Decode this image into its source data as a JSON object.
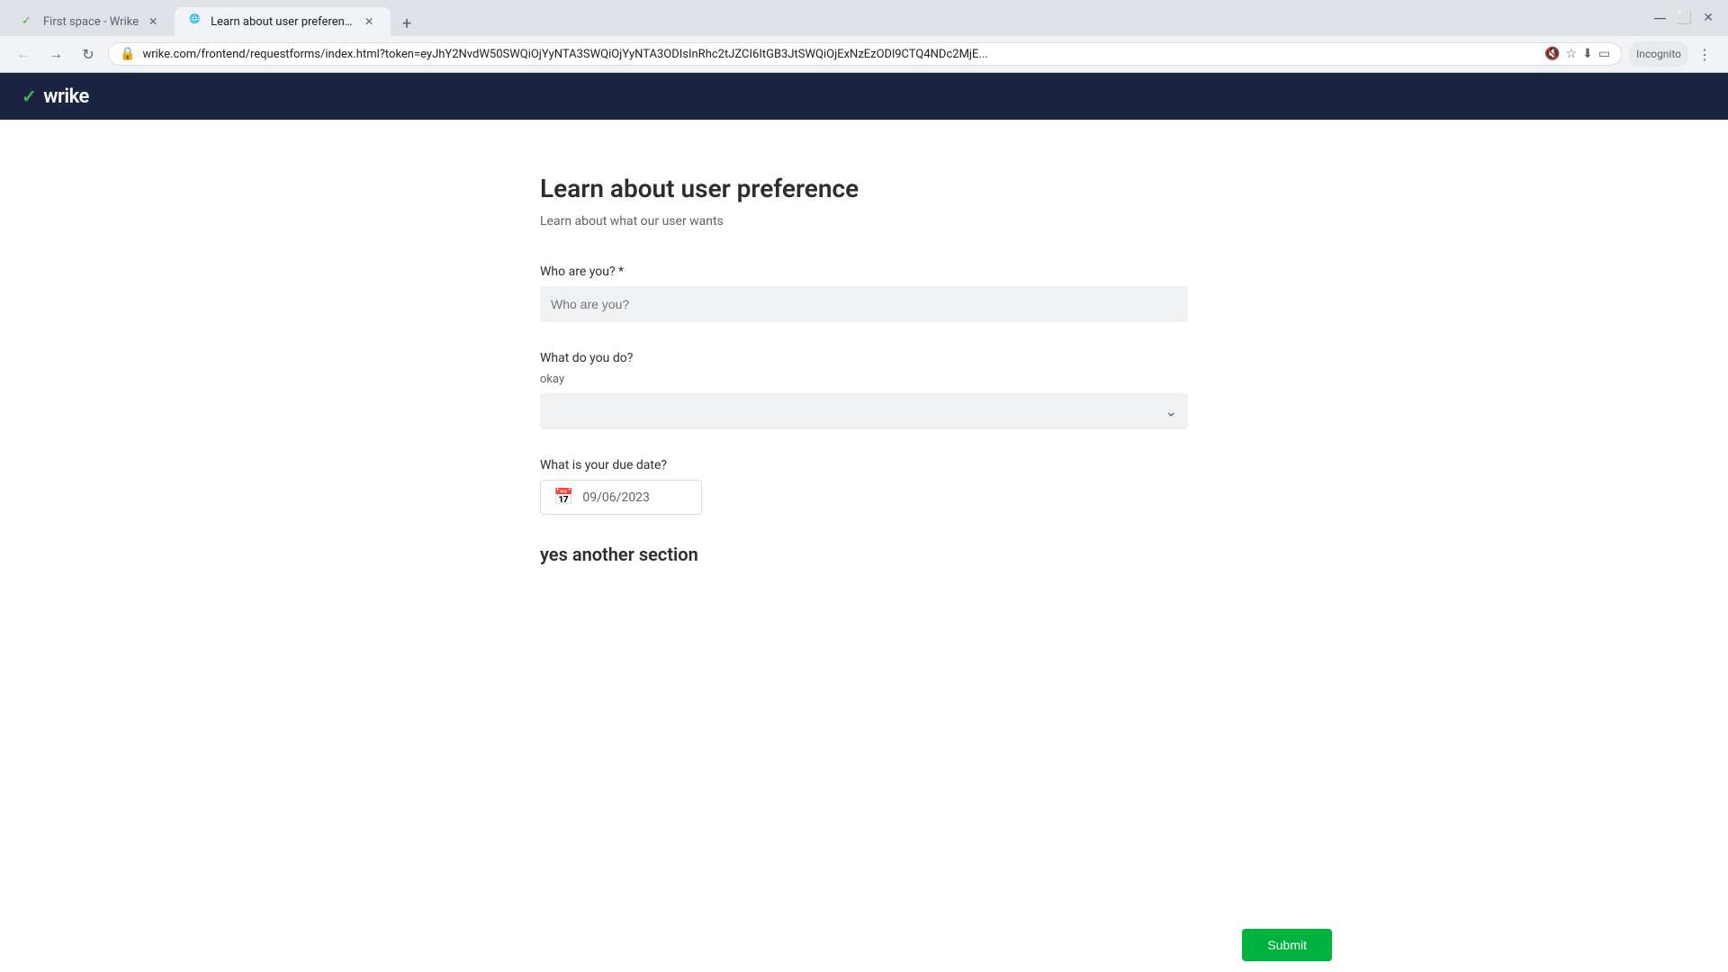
{
  "browser": {
    "tabs": [
      {
        "id": "tab-1",
        "title": "First space - Wrike",
        "favicon": "✓",
        "active": false,
        "closeable": true
      },
      {
        "id": "tab-2",
        "title": "Learn about user preference",
        "favicon": "●",
        "active": true,
        "closeable": true
      }
    ],
    "new_tab_label": "+",
    "url": "wrike.com/frontend/requestforms/index.html?token=eyJhY2NvdW50SWQiOjYyNTA3SWQiOjYyNTA3ODIsInRhc2tJZCI6ItGB3JtSWQiOjExNzEzODl9CTQ4NDc2MjE...",
    "toolbar": {
      "back_label": "←",
      "forward_label": "→",
      "reload_label": "↺",
      "incognito_label": "Incognito"
    }
  },
  "app": {
    "logo_text": "wrike",
    "logo_check": "✓"
  },
  "form": {
    "title": "Learn about user preference",
    "subtitle": "Learn about what our user wants",
    "fields": [
      {
        "id": "who-are-you",
        "label": "Who are you?",
        "required": true,
        "type": "text",
        "value": ""
      },
      {
        "id": "what-do-you-do",
        "label": "What do you do?",
        "required": false,
        "type": "dropdown",
        "description": "okay",
        "value": ""
      },
      {
        "id": "due-date",
        "label": "What is your due date?",
        "required": false,
        "type": "date",
        "value": "09/06/2023"
      }
    ],
    "sections": [
      {
        "id": "another-section",
        "label": "yes another section"
      }
    ],
    "submit_label": "Submit"
  }
}
